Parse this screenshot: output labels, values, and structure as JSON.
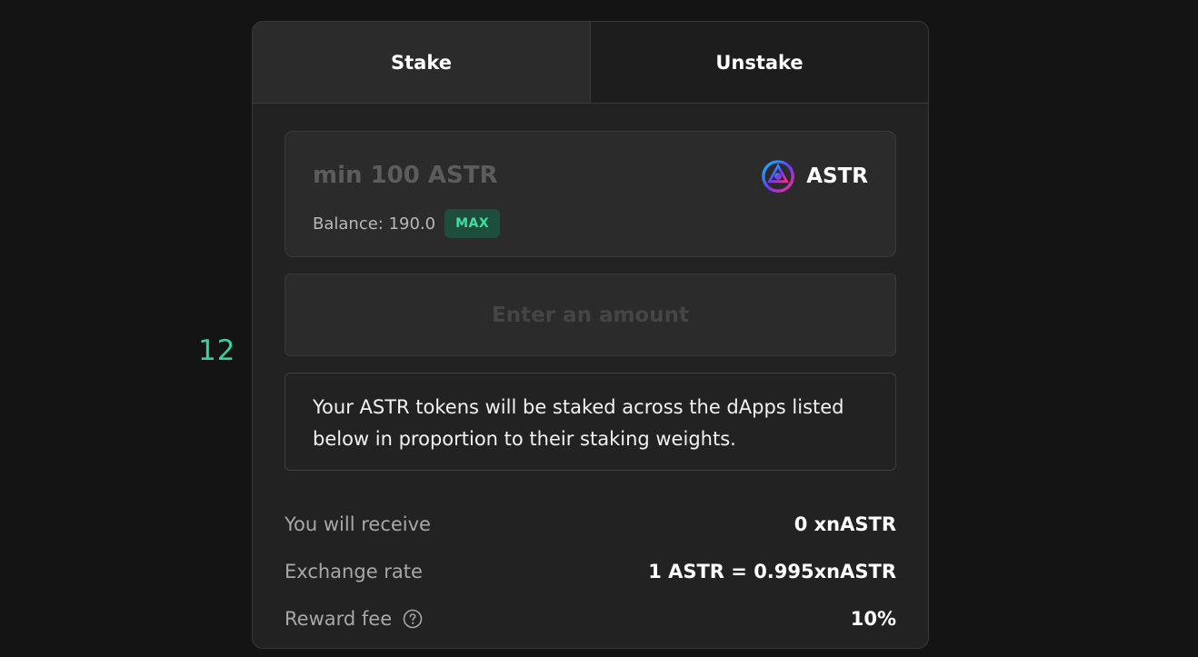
{
  "side_number": "12",
  "tabs": [
    {
      "label": "Stake",
      "active": true
    },
    {
      "label": "Unstake",
      "active": false
    }
  ],
  "amount_input": {
    "value": "",
    "placeholder": "min 100 ASTR"
  },
  "token": {
    "symbol": "ASTR",
    "icon": "astar-logo-icon"
  },
  "balance": {
    "text": "Balance: 190.0",
    "max_label": "MAX"
  },
  "submit_button": {
    "label": "Enter an amount",
    "disabled": true
  },
  "info_text": "Your ASTR tokens will be staked across the dApps listed below in proportion to their staking weights.",
  "summary": {
    "receive": {
      "label": "You will receive",
      "value": "0 xnASTR"
    },
    "exchange_rate": {
      "label": "Exchange rate",
      "value": "1 ASTR = 0.995xnASTR"
    },
    "reward_fee": {
      "label": "Reward fee",
      "value": "10%",
      "help_icon": "question-circle-icon"
    }
  },
  "colors": {
    "background": "#141414",
    "card": "#222222",
    "accent_green": "#35d29b",
    "max_bg": "#1f4d3b"
  }
}
